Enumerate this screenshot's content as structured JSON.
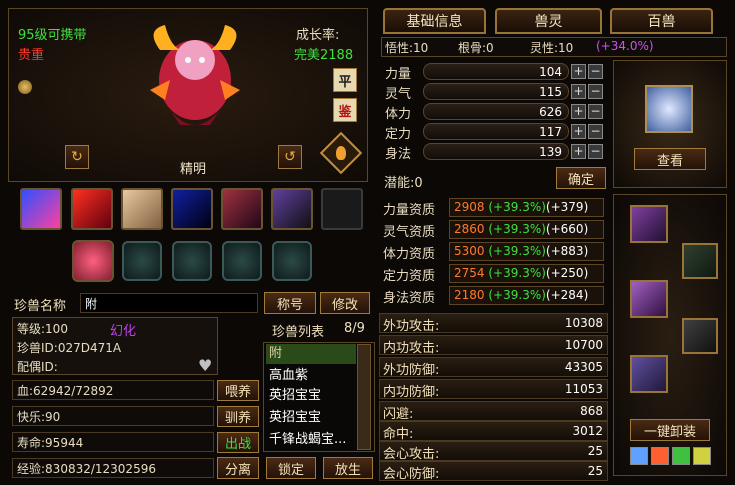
{
  "pet": {
    "level_text": "95级可携带",
    "rarity": "贵重",
    "growth_label": "成长率:",
    "growth_value": "完美2188",
    "personality": "精明",
    "btn_ping": "平",
    "btn_jian": "鉴"
  },
  "tabs": [
    "基础信息",
    "兽灵",
    "百兽"
  ],
  "attrs": {
    "wuxing_label": "悟性:10",
    "gengu_label": "根骨:0",
    "lingxing_label": "灵性:10",
    "lingxing_bonus": "(+34.0%)"
  },
  "stats": [
    {
      "label": "力量",
      "value": "104"
    },
    {
      "label": "灵气",
      "value": "115"
    },
    {
      "label": "体力",
      "value": "626"
    },
    {
      "label": "定力",
      "value": "117"
    },
    {
      "label": "身法",
      "value": "139"
    }
  ],
  "potential": "潜能:0",
  "confirm_label": "确定",
  "aptitudes": [
    {
      "label": "力量资质",
      "base": "2908",
      "pct": "(+39.3%)",
      "bonus": "(+379)",
      "color": "#ff7a2a"
    },
    {
      "label": "灵气资质",
      "base": "2860",
      "pct": "(+39.3%)",
      "bonus": "(+660)",
      "color": "#ff7a2a"
    },
    {
      "label": "体力资质",
      "base": "5300",
      "pct": "(+39.3%)",
      "bonus": "(+883)",
      "color": "#ff7a2a"
    },
    {
      "label": "定力资质",
      "base": "2754",
      "pct": "(+39.3%)",
      "bonus": "(+250)",
      "color": "#ff7a2a"
    },
    {
      "label": "身法资质",
      "base": "2180",
      "pct": "(+39.3%)",
      "bonus": "(+284)",
      "color": "#ff7a2a"
    }
  ],
  "combat": [
    {
      "label": "外功攻击:",
      "value": "10308"
    },
    {
      "label": "内功攻击:",
      "value": "10700"
    },
    {
      "label": "外功防御:",
      "value": "43305"
    },
    {
      "label": "内功防御:",
      "value": "11053"
    },
    {
      "label": "闪避:",
      "value": "868"
    },
    {
      "label": "命中:",
      "value": "3012"
    },
    {
      "label": "会心攻击:",
      "value": "25"
    },
    {
      "label": "会心防御:",
      "value": "25"
    }
  ],
  "name_label": "珍兽名称",
  "name_value": "附",
  "btn_title": "称号",
  "btn_modify": "修改",
  "info": {
    "level": "等级:100",
    "huanhua": "幻化",
    "pet_id": "珍兽ID:027D471A",
    "mate": "配偶ID:"
  },
  "list_title": "珍兽列表",
  "list_count": "8/9",
  "pet_list": [
    "附",
    "高血紫",
    "英招宝宝",
    "英招宝宝",
    "千锋战蝎宝..."
  ],
  "bars": {
    "hp": "血:62942/72892",
    "happy": "快乐:90",
    "life": "寿命:95944",
    "exp": "经验:830832/12302596"
  },
  "btn_feed": "喂养",
  "btn_tame": "驯养",
  "btn_fight": "出战",
  "btn_split": "分离",
  "btn_lock": "锁定",
  "btn_release": "放生",
  "btn_view": "查看",
  "btn_unequip": "一键卸装"
}
